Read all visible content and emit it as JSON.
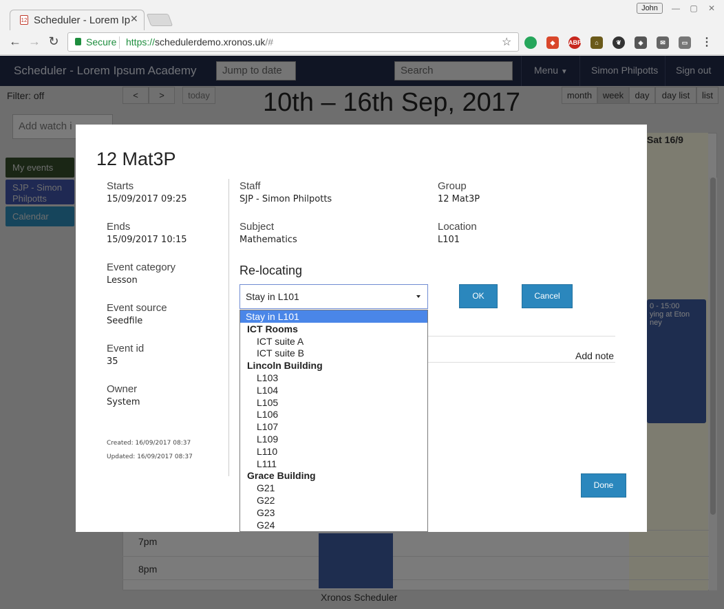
{
  "browser": {
    "tab_title": "Scheduler - Lorem Ipsum Academy",
    "user_badge": "John",
    "secure_label": "Secure",
    "url_scheme": "https://",
    "url_host": "schedulerdemo.xronos.uk",
    "url_fragment": "/#",
    "extensions": [
      "green-circle-icon",
      "extension-icon",
      "adblock-icon",
      "house-icon",
      "evernote-icon",
      "lastpass-icon",
      "mail-icon",
      "cast-icon",
      "more-icon"
    ]
  },
  "app": {
    "brand": "Scheduler - Lorem Ipsum Academy",
    "jump_placeholder": "Jump to date",
    "search_placeholder": "Search",
    "menu_label": "Menu",
    "user_name": "Simon Philpotts",
    "signout_label": "Sign out",
    "filter_label": "Filter: off",
    "watch_placeholder": "Add watch i",
    "calendars": [
      "My events",
      "SJP - Simon Philpotts",
      "Calendar"
    ],
    "calendar_colors": [
      "#344d2b",
      "#3f53a6",
      "#2d8bb8"
    ],
    "today_label": "today",
    "week_title": "10th – 16th Sep, 2017",
    "views": [
      "month",
      "week",
      "day",
      "day list",
      "list"
    ],
    "active_view": "week",
    "sat_header": "Sat 16/9",
    "sat_event_time": "0 - 15:00",
    "sat_event_title": "ying at Eton ney",
    "time_labels": [
      "7pm",
      "8pm"
    ],
    "footer": "Xronos Scheduler"
  },
  "modal": {
    "title": "12 Mat3P",
    "starts_label": "Starts",
    "starts_value": "15/09/2017 09:25",
    "ends_label": "Ends",
    "ends_value": "15/09/2017 10:15",
    "category_label": "Event category",
    "category_value": "Lesson",
    "source_label": "Event source",
    "source_value": "Seedfile",
    "id_label": "Event id",
    "id_value": "35",
    "owner_label": "Owner",
    "owner_value": "System",
    "created": "Created: 16/09/2017 08:37",
    "updated": "Updated: 16/09/2017 08:37",
    "staff_label": "Staff",
    "staff_value": "SJP - Simon Philpotts",
    "group_label": "Group",
    "group_value": "12 Mat3P",
    "subject_label": "Subject",
    "subject_value": "Mathematics",
    "location_label": "Location",
    "location_value": "L101",
    "relocating_label": "Re-locating",
    "select_value": "Stay in L101",
    "ok_label": "OK",
    "cancel_label": "Cancel",
    "add_note_label": "Add note",
    "done_label": "Done"
  },
  "dropdown": {
    "selected": "Stay in L101",
    "groups": [
      {
        "label": "ICT Rooms",
        "options": [
          "ICT suite A",
          "ICT suite B"
        ]
      },
      {
        "label": "Lincoln Building",
        "options": [
          "L103",
          "L104",
          "L105",
          "L106",
          "L107",
          "L109",
          "L110",
          "L111"
        ]
      },
      {
        "label": "Grace Building",
        "options": [
          "G21",
          "G22",
          "G23",
          "G24"
        ]
      }
    ]
  }
}
